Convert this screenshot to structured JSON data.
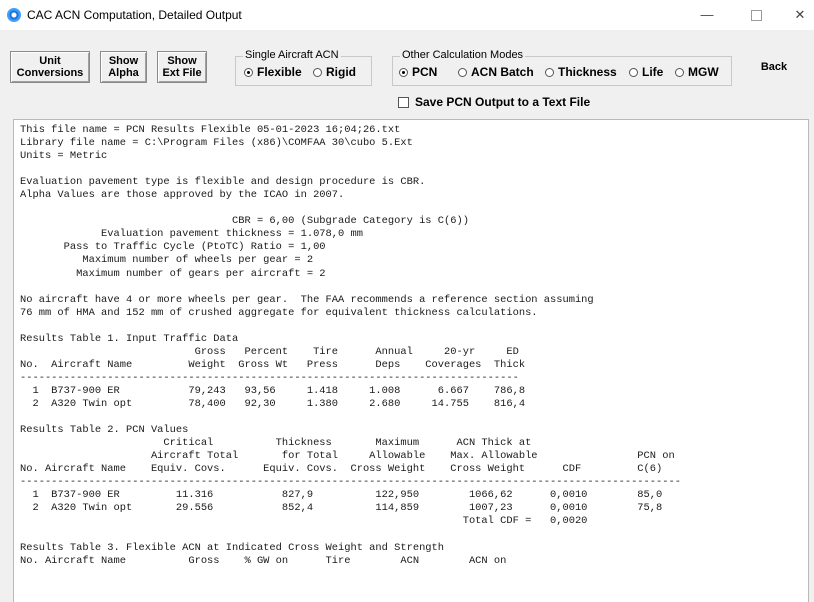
{
  "window": {
    "title": "CAC ACN Computation, Detailed Output",
    "minimize_symbol": "—",
    "close_symbol": "✕"
  },
  "toolbar": {
    "unit_conversions": "Unit\nConversions",
    "show_alpha": "Show\nAlpha",
    "show_ext_file": "Show\nExt File",
    "back": "Back"
  },
  "single_aircraft_acn": {
    "title": "Single Aircraft ACN",
    "options": [
      "Flexible",
      "Rigid"
    ],
    "selected": "Flexible"
  },
  "other_calculation_modes": {
    "title": "Other Calculation Modes",
    "options": [
      "PCN",
      "ACN Batch",
      "Thickness",
      "Life",
      "MGW"
    ],
    "selected": "PCN"
  },
  "save_pcn": {
    "label": "Save PCN Output to a Text File",
    "checked": false
  },
  "output_lines": [
    "This file name = PCN Results Flexible 05-01-2023 16;04;26.txt",
    "Library file name = C:\\Program Files (x86)\\COMFAA 30\\cubo 5.Ext",
    "Units = Metric",
    "",
    "Evaluation pavement type is flexible and design procedure is CBR.",
    "Alpha Values are those approved by the ICAO in 2007.",
    "",
    "                                  CBR = 6,00 (Subgrade Category is C(6))",
    "             Evaluation pavement thickness = 1.078,0 mm",
    "       Pass to Traffic Cycle (PtoTC) Ratio = 1,00",
    "          Maximum number of wheels per gear = 2",
    "         Maximum number of gears per aircraft = 2",
    "",
    "No aircraft have 4 or more wheels per gear.  The FAA recommends a reference section assuming",
    "76 mm of HMA and 152 mm of crushed aggregate for equivalent thickness calculations.",
    "",
    "Results Table 1. Input Traffic Data",
    "                            Gross   Percent    Tire      Annual     20-yr     ED",
    "No.  Aircraft Name         Weight  Gross Wt   Press      Deps    Coverages  Thick",
    "--------------------------------------------------------------------------------",
    "  1  B737-900 ER           79,243   93,56     1.418     1.008      6.667    786,8",
    "  2  A320 Twin opt         78,400   92,30     1.380     2.680     14.755    816,4",
    "",
    "Results Table 2. PCN Values",
    "                       Critical          Thickness       Maximum      ACN Thick at",
    "                     Aircraft Total       for Total     Allowable    Max. Allowable                PCN on",
    "No. Aircraft Name    Equiv. Covs.      Equiv. Covs.  Cross Weight    Cross Weight      CDF         C(6)",
    "----------------------------------------------------------------------------------------------------------",
    "  1  B737-900 ER         11.316           827,9          122,950        1066,62      0,0010        85,0",
    "  2  A320 Twin opt       29.556           852,4          114,859        1007,23      0,0010        75,8",
    "                                                                       Total CDF =   0,0020",
    "",
    "Results Table 3. Flexible ACN at Indicated Cross Weight and Strength",
    "No. Aircraft Name          Gross    % GW on      Tire        ACN        ACN on"
  ]
}
